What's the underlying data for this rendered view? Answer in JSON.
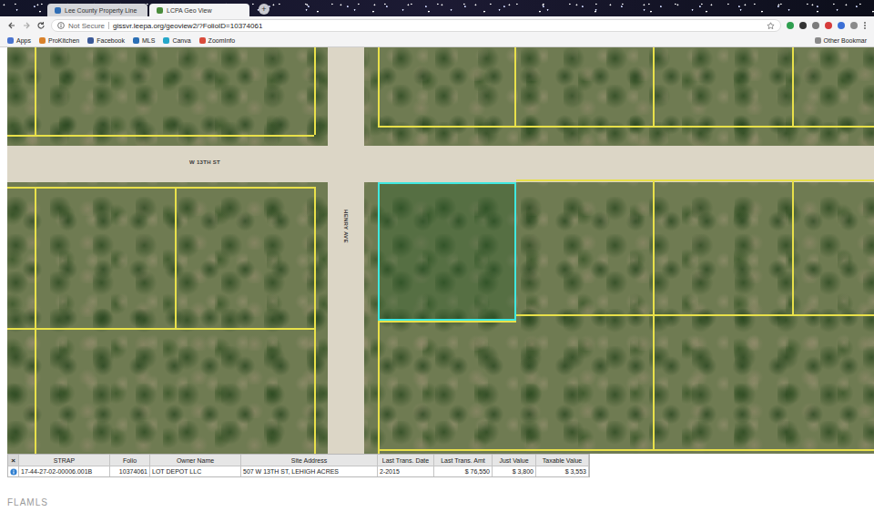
{
  "browser": {
    "tabs": [
      {
        "label": "Lee County Property Line",
        "selected": false
      },
      {
        "label": "LCPA Geo View",
        "selected": true
      }
    ],
    "new_tab": "+",
    "security": "Not Secure",
    "url": "gissvr.leepa.org/geoview2/?FolioID=10374061",
    "bookmarks": [
      "Apps",
      "ProKitchen",
      "Facebook",
      "MLS",
      "Canva",
      "ZoomInfo"
    ],
    "other_bookmarks": "Other Bookmar"
  },
  "map": {
    "streets": [
      {
        "label": "W 13TH ST",
        "kind": "horizontal"
      },
      {
        "label": "HENRY AVE",
        "kind": "vertical"
      }
    ]
  },
  "table": {
    "close": "×",
    "columns": [
      "STRAP",
      "Folio",
      "Owner Name",
      "Site Address",
      "Last Trans. Date",
      "Last Trans. Amt",
      "Just Value",
      "Taxable Value"
    ],
    "rows": [
      [
        "17-44-27-02-00006.001B",
        "10374061",
        "LOT DEPOT LLC",
        "507 W 13TH ST, LEHIGH ACRES",
        "2-2015",
        "$ 76,550",
        "$ 3,800",
        "$ 3,553"
      ]
    ]
  },
  "watermark": "FLAMLS"
}
